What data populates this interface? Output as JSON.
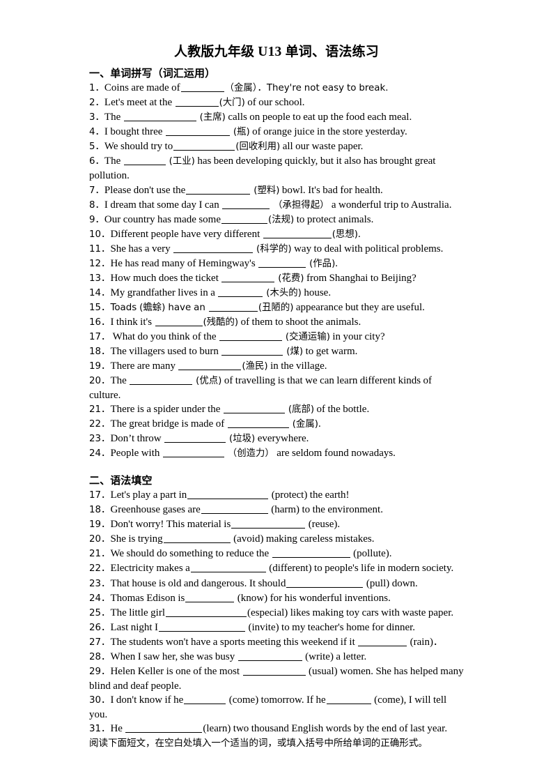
{
  "document": {
    "title_cn": "人教版九年级",
    "title_mid": " U13 ",
    "title_cn2": "单词、语法练习"
  },
  "section1": {
    "heading": "一、单词拼写（词汇运用）",
    "items": [
      {
        "num": "1．",
        "pre": "Coins are made of",
        "blank": 62,
        "hint": "（金属）",
        "post": "．They're not easy to break."
      },
      {
        "num": "2．",
        "pre": "Let's meet at the ",
        "blank": 62,
        "hint": "(大门)",
        "post": " of our school."
      },
      {
        "num": "3．",
        "pre": "The ",
        "blank": 104,
        "hint": " (主席)",
        "post": " calls on people to eat up the food each meal."
      },
      {
        "num": "4．",
        "pre": "I bought three ",
        "blank": 92,
        "hint": " (瓶)",
        "post": " of orange juice in the store yesterday."
      },
      {
        "num": "5．",
        "pre": "We should try to",
        "blank": 88,
        "hint": "(回收利用)",
        "post": " all our waste paper."
      },
      {
        "num": "6．",
        "pre": "The ",
        "blank": 60,
        "hint": " (工业)",
        "post": " has been developing quickly, but it also has brought great pollution."
      },
      {
        "num": "7．",
        "pre": "Please don't use the",
        "blank": 92,
        "hint": " (塑料)",
        "post": " bowl. It's bad for health."
      },
      {
        "num": "8．",
        "pre": "I dream that some day I can ",
        "blank": 68,
        "hint": " （承担得起）",
        "post": " a wonderful trip to Australia."
      },
      {
        "num": "9．",
        "pre": "Our country has made some",
        "blank": 66,
        "hint": "(法规)",
        "post": " to protect animals."
      },
      {
        "num": "10．",
        "pre": "Different people have very different ",
        "blank": 98,
        "hint": "(思想)",
        "post": "."
      },
      {
        "num": "11．",
        "pre": "She has a very ",
        "blank": 114,
        "hint": " (科学的)",
        "post": " way to deal with political problems."
      },
      {
        "num": "12．",
        "pre": "He has read many of Hemingway's ",
        "blank": 68,
        "hint": " (作品)",
        "post": "."
      },
      {
        "num": "13．",
        "pre": "How much does the ticket ",
        "blank": 76,
        "hint": " (花费)",
        "post": " from Shanghai to Beijing?"
      },
      {
        "num": "14．",
        "pre": "My grandfather lives in a ",
        "blank": 64,
        "hint": " (木头的)",
        "post": " house."
      },
      {
        "num": "15．",
        "pre": "Toads (蟾蜍) have an ",
        "blank": 70,
        "hint": "(丑陋的)",
        "post": " appearance but they are useful."
      },
      {
        "num": "16．",
        "pre": "I think it's ",
        "blank": 68,
        "hint": "(残酷的)",
        "post": " of them to shoot the animals."
      },
      {
        "num": "17．",
        "pre": "  What do you think of the ",
        "blank": 90,
        "hint": " (交通运输)",
        "post": " in your city?"
      },
      {
        "num": "18．",
        "pre": "The villagers used to burn ",
        "blank": 88,
        "hint": " (煤)",
        "post": " to get warm."
      },
      {
        "num": "19．",
        "pre": "There are many ",
        "blank": 90,
        "hint": "(渔民)",
        "post": " in the village."
      },
      {
        "num": "20．",
        "pre": "The ",
        "blank": 90,
        "hint": " (优点)",
        "post": " of travelling is that we can learn different kinds of culture."
      },
      {
        "num": "21．",
        "pre": "There is a spider under the ",
        "blank": 88,
        "hint": " (底部)",
        "post": " of the bottle."
      },
      {
        "num": "22．",
        "pre": "The great bridge is made of ",
        "blank": 88,
        "hint": " (金属)",
        "post": "."
      },
      {
        "num": "23．",
        "pre": "Don’t throw ",
        "blank": 88,
        "hint": " (垃圾)",
        "post": " everywhere."
      },
      {
        "num": "24．",
        "pre": "People with ",
        "blank": 88,
        "hint": " （创造力）",
        "post": " are seldom found nowadays."
      }
    ]
  },
  "section2": {
    "heading": "二、语法填空",
    "items": [
      {
        "num": "17．",
        "pre": "Let's play a part in",
        "blank": 116,
        "hint": " (protect)",
        "post": " the earth!"
      },
      {
        "num": "18．",
        "pre": "Greenhouse gases are",
        "blank": 96,
        "hint": " (harm)",
        "post": " to the environment."
      },
      {
        "num": "19．",
        "pre": "Don't worry! This material is",
        "blank": 106,
        "hint": " (reuse)",
        "post": "."
      },
      {
        "num": "20．",
        "pre": "She is trying",
        "blank": 96,
        "hint": " (avoid)",
        "post": " making careless mistakes."
      },
      {
        "num": "21．",
        "pre": "We should do something to reduce the ",
        "blank": 112,
        "hint": " (pollute)",
        "post": "."
      },
      {
        "num": "22．",
        "pre": "Electricity makes a",
        "blank": 108,
        "hint": " (different)",
        "post": " to people's life in modern society."
      },
      {
        "num": "23．",
        "pre": "That house is old and dangerous. It should",
        "blank": 110,
        "hint": " (pull)",
        "post": " down."
      },
      {
        "num": "24．",
        "pre": "Thomas Edison is",
        "blank": 70,
        "hint": " (know)",
        "post": " for his wonderful inventions."
      },
      {
        "num": "25．",
        "pre": "The little girl",
        "blank": 116,
        "hint": "(especial)",
        "post": " likes making toy cars with waste paper."
      },
      {
        "num": "26．",
        "pre": "Last night I",
        "blank": 124,
        "hint": " (invite)",
        "post": " to my teacher's home for dinner."
      },
      {
        "num": "27．",
        "pre": "The students won't have a sports meeting this weekend if it ",
        "blank": 70,
        "hint": " (rain)",
        "post": "．"
      },
      {
        "num": "28．",
        "pre": "When I saw her, she was busy ",
        "blank": 92,
        "hint": " (write)",
        "post": " a letter."
      },
      {
        "num": "29．",
        "pre": "Helen Keller is one of the most ",
        "blank": 90,
        "hint": " (usual)",
        "post": " women. She has helped many blind and deaf people."
      },
      {
        "num": "30．",
        "pre": "I don't know if he",
        "blank": 60,
        "hint": " (come)",
        "post": " tomorrow. If he",
        "blank2": 64,
        "hint2": " (come)",
        "post2": ", I will tell you."
      },
      {
        "num": "31．",
        "pre": "He ",
        "blank": 110,
        "hint": "(learn)",
        "post": " two thousand English words by the end of last year."
      }
    ]
  },
  "footer": {
    "note": "阅读下面短文，在空白处填入一个适当的词，或填入括号中所给单词的正确形式。"
  }
}
